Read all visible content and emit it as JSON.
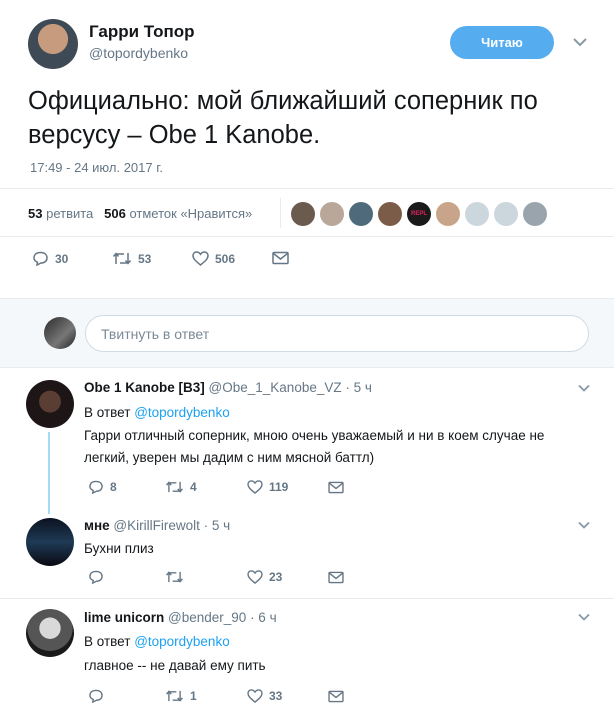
{
  "tweet": {
    "author_name": "Гарри Топор",
    "author_handle": "@topordybenko",
    "follow_label": "Читаю",
    "text": "Официально: мой ближайший соперник по версусу – Obe 1 Kanobe.",
    "timestamp": "17:49 - 24 июл. 2017 г.",
    "retweets_count": "53",
    "retweets_label": "ретвита",
    "likes_count": "506",
    "likes_label": "отметок «Нравится»",
    "actions": {
      "replies": "30",
      "retweets": "53",
      "likes": "506"
    }
  },
  "likers": [
    {
      "icon": "liker-avatar",
      "color": "#6b5a4e"
    },
    {
      "icon": "liker-avatar",
      "color": "#b9a79a"
    },
    {
      "icon": "liker-avatar",
      "color": "#4f6a7a"
    },
    {
      "icon": "liker-avatar",
      "color": "#7a5c48"
    },
    {
      "icon": "liker-avatar-repl",
      "color": "#1a1a1a",
      "label": "REPL"
    },
    {
      "icon": "liker-avatar",
      "color": "#c8a58a"
    },
    {
      "icon": "default-avatar",
      "color": "#ccd6dd"
    },
    {
      "icon": "default-avatar",
      "color": "#ccd6dd"
    },
    {
      "icon": "liker-avatar",
      "color": "#9aa4ac"
    }
  ],
  "reply_box": {
    "placeholder": "Твитнуть в ответ"
  },
  "replies": [
    {
      "name": "Obe 1 Kanobe [B3]",
      "handle": "@Obe_1_Kanobe_VZ",
      "time": "· 5 ч",
      "in_reply_label": "В ответ",
      "in_reply_to": "@topordybenko",
      "text_line1": "Гарри отличный соперник, мною очень уважаемый и ни в коем случае не",
      "text_line2": "легкий, уверен мы дадим с ним мясной баттл)",
      "replies": "8",
      "retweets": "4",
      "likes": "119"
    },
    {
      "name": "мне",
      "handle": "@KirillFirewolt",
      "time": "· 5 ч",
      "text_line1": "Бухни плиз",
      "replies": "",
      "retweets": "",
      "likes": "23"
    },
    {
      "name": "lime unicorn",
      "handle": "@bender_90",
      "time": "· 6 ч",
      "in_reply_label": "В ответ",
      "in_reply_to": "@topordybenko",
      "text_line1": "главное -- не давай ему пить",
      "replies": "",
      "retweets": "1",
      "likes": "33"
    }
  ],
  "colors": {
    "accent": "#1da1f2",
    "follow_bg": "#55acee",
    "muted": "#657786"
  }
}
